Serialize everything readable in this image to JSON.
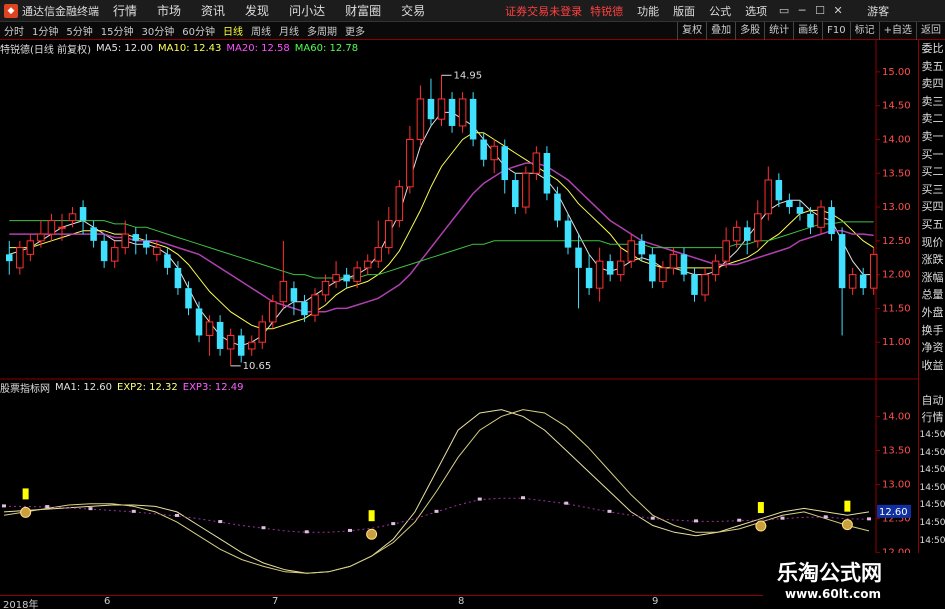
{
  "app": {
    "title": "通达信金融终端",
    "login_status": "证券交易未登录",
    "stock_name": "特锐德",
    "guest": "游客",
    "menus": [
      "行情",
      "市场",
      "资讯",
      "发现",
      "问小达",
      "财富圈",
      "交易"
    ],
    "right_menus": [
      "功能",
      "版面",
      "公式",
      "选项"
    ],
    "window_controls": [
      "▭",
      "─",
      "☐",
      "✕"
    ]
  },
  "toolbar": {
    "periods": [
      "分时",
      "1分钟",
      "5分钟",
      "15分钟",
      "30分钟",
      "60分钟",
      "日线",
      "周线",
      "月线",
      "多周期",
      "更多"
    ],
    "active_period": "日线",
    "right_buttons": [
      "复权",
      "叠加",
      "多股",
      "统计",
      "画线",
      "F10",
      "标记",
      "+自选",
      "返回"
    ]
  },
  "main_panel": {
    "stock_label": "特锐德(日线 前复权)",
    "ma": [
      {
        "label": "MA5: 12.00",
        "color": "#e0e0e0"
      },
      {
        "label": "MA10: 12.43",
        "color": "#ffff50"
      },
      {
        "label": "MA20: 12.58",
        "color": "#ff50ff"
      },
      {
        "label": "MA60: 12.78",
        "color": "#50ff50"
      }
    ],
    "high_label": "14.95",
    "low_label": "10.65",
    "y_ticks": [
      "15.00",
      "14.50",
      "14.00",
      "13.50",
      "13.00",
      "12.50",
      "12.00",
      "11.50",
      "11.00"
    ]
  },
  "sub_panel": {
    "indicator_label": "股票指标网",
    "lines": [
      {
        "label": "MA1: 12.60",
        "color": "#e0e0e0"
      },
      {
        "label": "EXP2: 12.32",
        "color": "#ffff80"
      },
      {
        "label": "EXP3: 12.49",
        "color": "#ff60ff"
      }
    ],
    "y_ticks": [
      "14.00",
      "13.50",
      "13.00",
      "12.50",
      "12.00"
    ],
    "current_value": "12.60"
  },
  "x_axis": {
    "labels": [
      "2018年",
      "6",
      "7",
      "8",
      "9"
    ]
  },
  "side_panel": {
    "labels": [
      "委比",
      "卖五",
      "卖四",
      "卖三",
      "卖二",
      "卖一",
      "买一",
      "买二",
      "买三",
      "买四",
      "买五",
      "现价",
      "涨跌",
      "涨幅",
      "总量",
      "外盘",
      "换手",
      "净资",
      "收益",
      "",
      "自动",
      "行情",
      "14:50",
      "14:50",
      "14:50",
      "14:50",
      "14:50",
      "14:50",
      "14:50",
      "14:50"
    ]
  },
  "watermark": {
    "title": "乐淘公式网",
    "url": "www.60lt.com"
  },
  "chart_data": {
    "type": "candlestick",
    "ylim": [
      10.5,
      15.25
    ],
    "candles": [
      [
        12.3,
        12.2,
        12.5,
        12.0
      ],
      [
        12.1,
        12.4,
        12.5,
        12.0
      ],
      [
        12.3,
        12.5,
        12.6,
        12.2
      ],
      [
        12.5,
        12.6,
        12.8,
        12.4
      ],
      [
        12.6,
        12.8,
        12.9,
        12.5
      ],
      [
        12.7,
        12.7,
        12.9,
        12.5
      ],
      [
        12.8,
        12.9,
        13.0,
        12.7
      ],
      [
        13.0,
        12.8,
        13.1,
        12.6
      ],
      [
        12.7,
        12.5,
        12.8,
        12.4
      ],
      [
        12.5,
        12.2,
        12.6,
        12.1
      ],
      [
        12.2,
        12.4,
        12.5,
        12.1
      ],
      [
        12.4,
        12.6,
        12.8,
        12.3
      ],
      [
        12.6,
        12.5,
        12.7,
        12.3
      ],
      [
        12.5,
        12.4,
        12.6,
        12.3
      ],
      [
        12.3,
        12.4,
        12.5,
        12.2
      ],
      [
        12.3,
        12.1,
        12.4,
        12.0
      ],
      [
        12.1,
        11.8,
        12.2,
        11.7
      ],
      [
        11.8,
        11.5,
        11.9,
        11.4
      ],
      [
        11.5,
        11.1,
        11.6,
        11.0
      ],
      [
        11.1,
        11.3,
        11.4,
        10.8
      ],
      [
        11.3,
        10.9,
        11.4,
        10.8
      ],
      [
        10.9,
        11.1,
        11.2,
        10.65
      ],
      [
        11.1,
        10.8,
        11.2,
        10.7
      ],
      [
        10.9,
        11.0,
        11.1,
        10.8
      ],
      [
        11.0,
        11.3,
        11.4,
        10.9
      ],
      [
        11.3,
        11.6,
        11.7,
        11.2
      ],
      [
        11.6,
        11.9,
        12.5,
        11.5
      ],
      [
        11.8,
        11.6,
        11.9,
        11.4
      ],
      [
        11.6,
        11.4,
        11.7,
        11.3
      ],
      [
        11.4,
        11.7,
        11.8,
        11.3
      ],
      [
        11.7,
        11.9,
        12.0,
        11.6
      ],
      [
        11.9,
        12.0,
        12.2,
        11.8
      ],
      [
        12.0,
        11.9,
        12.1,
        11.8
      ],
      [
        11.9,
        12.1,
        12.2,
        11.8
      ],
      [
        12.1,
        12.2,
        12.3,
        12.0
      ],
      [
        12.2,
        12.4,
        12.8,
        12.1
      ],
      [
        12.4,
        12.8,
        13.0,
        12.3
      ],
      [
        12.8,
        13.3,
        13.4,
        12.7
      ],
      [
        13.3,
        14.0,
        14.2,
        13.2
      ],
      [
        14.0,
        14.6,
        14.8,
        13.9
      ],
      [
        14.6,
        14.3,
        14.9,
        14.2
      ],
      [
        14.3,
        14.6,
        14.95,
        14.2
      ],
      [
        14.6,
        14.2,
        14.7,
        14.1
      ],
      [
        14.2,
        14.6,
        14.7,
        14.1
      ],
      [
        14.6,
        14.0,
        14.7,
        13.9
      ],
      [
        14.0,
        13.7,
        14.1,
        13.6
      ],
      [
        13.7,
        13.9,
        14.0,
        13.5
      ],
      [
        13.9,
        13.4,
        14.0,
        13.2
      ],
      [
        13.4,
        13.0,
        13.5,
        12.9
      ],
      [
        13.0,
        13.5,
        13.6,
        12.9
      ],
      [
        13.5,
        13.8,
        13.9,
        13.4
      ],
      [
        13.8,
        13.2,
        13.9,
        13.1
      ],
      [
        13.2,
        12.8,
        13.3,
        12.7
      ],
      [
        12.8,
        12.4,
        12.9,
        12.3
      ],
      [
        12.4,
        12.1,
        12.6,
        11.5
      ],
      [
        12.1,
        11.8,
        12.3,
        11.7
      ],
      [
        11.8,
        12.2,
        12.4,
        11.6
      ],
      [
        12.2,
        12.0,
        12.3,
        11.9
      ],
      [
        12.0,
        12.2,
        12.4,
        11.9
      ],
      [
        12.2,
        12.5,
        12.6,
        12.1
      ],
      [
        12.5,
        12.3,
        12.6,
        12.2
      ],
      [
        12.3,
        11.9,
        12.4,
        11.8
      ],
      [
        11.9,
        12.1,
        12.2,
        11.8
      ],
      [
        12.1,
        12.3,
        12.4,
        12.0
      ],
      [
        12.3,
        12.0,
        12.4,
        11.9
      ],
      [
        12.0,
        11.7,
        12.1,
        11.6
      ],
      [
        11.7,
        12.0,
        12.1,
        11.6
      ],
      [
        12.0,
        12.2,
        12.3,
        11.9
      ],
      [
        12.2,
        12.5,
        12.7,
        12.1
      ],
      [
        12.5,
        12.7,
        12.8,
        12.4
      ],
      [
        12.7,
        12.5,
        12.8,
        12.3
      ],
      [
        12.5,
        12.9,
        13.1,
        12.4
      ],
      [
        12.9,
        13.4,
        13.6,
        12.8
      ],
      [
        13.4,
        13.1,
        13.5,
        13.0
      ],
      [
        13.1,
        13.0,
        13.2,
        12.9
      ],
      [
        13.0,
        12.9,
        13.1,
        12.8
      ],
      [
        12.9,
        12.7,
        13.0,
        12.6
      ],
      [
        12.7,
        13.0,
        13.1,
        12.6
      ],
      [
        13.0,
        12.6,
        13.1,
        12.5
      ],
      [
        12.6,
        11.8,
        12.7,
        11.1
      ],
      [
        11.8,
        12.0,
        12.1,
        11.7
      ],
      [
        12.0,
        11.8,
        12.1,
        11.7
      ],
      [
        11.8,
        12.3,
        12.4,
        11.7
      ]
    ],
    "series": [
      {
        "name": "MA5",
        "values": [
          12.3,
          12.35,
          12.4,
          12.5,
          12.6,
          12.7,
          12.75,
          12.8,
          12.7,
          12.6,
          12.5,
          12.5,
          12.45,
          12.45,
          12.4,
          12.3,
          12.1,
          11.8,
          11.5,
          11.3,
          11.1,
          11.0,
          10.95,
          11.0,
          11.1,
          11.3,
          11.5,
          11.6,
          11.6,
          11.7,
          11.8,
          11.9,
          11.95,
          12.0,
          12.1,
          12.3,
          12.6,
          12.9,
          13.4,
          13.9,
          14.2,
          14.4,
          14.4,
          14.3,
          14.2,
          14.0,
          13.8,
          13.6,
          13.5,
          13.5,
          13.5,
          13.4,
          13.2,
          12.9,
          12.6,
          12.3,
          12.1,
          12.05,
          12.1,
          12.2,
          12.25,
          12.2,
          12.1,
          12.1,
          12.05,
          12.0,
          12.0,
          12.05,
          12.2,
          12.35,
          12.55,
          12.75,
          12.95,
          13.05,
          13.1,
          13.1,
          12.95,
          12.85,
          12.8,
          12.5,
          12.2,
          12.0,
          12.0
        ]
      },
      {
        "name": "MA10",
        "values": [
          12.4,
          12.4,
          12.4,
          12.45,
          12.5,
          12.55,
          12.6,
          12.65,
          12.65,
          12.65,
          12.6,
          12.6,
          12.55,
          12.5,
          12.45,
          12.4,
          12.3,
          12.15,
          11.95,
          11.75,
          11.6,
          11.45,
          11.35,
          11.25,
          11.2,
          11.2,
          11.25,
          11.3,
          11.35,
          11.45,
          11.55,
          11.7,
          11.8,
          11.85,
          11.9,
          12.0,
          12.15,
          12.35,
          12.65,
          12.95,
          13.3,
          13.6,
          13.8,
          14.0,
          14.1,
          14.1,
          14.0,
          13.9,
          13.8,
          13.7,
          13.6,
          13.5,
          13.4,
          13.25,
          13.05,
          12.9,
          12.75,
          12.6,
          12.4,
          12.3,
          12.2,
          12.15,
          12.1,
          12.1,
          12.1,
          12.1,
          12.1,
          12.1,
          12.15,
          12.2,
          12.25,
          12.35,
          12.5,
          12.6,
          12.75,
          12.9,
          12.95,
          12.95,
          12.9,
          12.8,
          12.65,
          12.5,
          12.4
        ]
      },
      {
        "name": "MA20",
        "values": [
          12.6,
          12.6,
          12.6,
          12.6,
          12.6,
          12.6,
          12.6,
          12.6,
          12.6,
          12.6,
          12.55,
          12.55,
          12.5,
          12.5,
          12.5,
          12.45,
          12.4,
          12.35,
          12.3,
          12.2,
          12.1,
          12.0,
          11.9,
          11.8,
          11.7,
          11.6,
          11.55,
          11.5,
          11.45,
          11.45,
          11.45,
          11.5,
          11.5,
          11.55,
          11.6,
          11.65,
          11.75,
          11.85,
          12.0,
          12.2,
          12.4,
          12.6,
          12.8,
          13.0,
          13.2,
          13.35,
          13.45,
          13.55,
          13.6,
          13.65,
          13.65,
          13.6,
          13.5,
          13.4,
          13.25,
          13.1,
          12.95,
          12.8,
          12.7,
          12.6,
          12.5,
          12.45,
          12.4,
          12.35,
          12.3,
          12.25,
          12.2,
          12.15,
          12.15,
          12.15,
          12.2,
          12.25,
          12.3,
          12.35,
          12.4,
          12.5,
          12.55,
          12.6,
          12.65,
          12.65,
          12.6,
          12.6,
          12.58
        ]
      },
      {
        "name": "MA60",
        "values": [
          12.8,
          12.8,
          12.8,
          12.8,
          12.8,
          12.8,
          12.8,
          12.8,
          12.8,
          12.8,
          12.75,
          12.75,
          12.7,
          12.7,
          12.65,
          12.6,
          12.55,
          12.5,
          12.45,
          12.4,
          12.35,
          12.3,
          12.25,
          12.2,
          12.15,
          12.1,
          12.05,
          12.0,
          12.0,
          11.95,
          11.95,
          11.95,
          11.95,
          11.95,
          12.0,
          12.0,
          12.05,
          12.1,
          12.15,
          12.2,
          12.25,
          12.3,
          12.35,
          12.4,
          12.45,
          12.45,
          12.5,
          12.5,
          12.5,
          12.5,
          12.5,
          12.5,
          12.5,
          12.5,
          12.5,
          12.5,
          12.5,
          12.45,
          12.45,
          12.45,
          12.45,
          12.4,
          12.4,
          12.4,
          12.4,
          12.4,
          12.4,
          12.4,
          12.4,
          12.45,
          12.45,
          12.5,
          12.5,
          12.55,
          12.6,
          12.65,
          12.7,
          12.75,
          12.75,
          12.78,
          12.78,
          12.78,
          12.78
        ]
      }
    ],
    "sub": {
      "ylim": [
        11.6,
        14.3
      ],
      "series": [
        {
          "name": "MA1",
          "values": [
            12.6,
            12.62,
            12.64,
            12.66,
            12.68,
            12.7,
            12.7,
            12.68,
            12.6,
            12.4,
            12.2,
            12.0,
            11.85,
            11.75,
            11.7,
            11.72,
            11.8,
            11.95,
            12.2,
            12.6,
            13.2,
            13.8,
            14.05,
            14.1,
            14.0,
            13.8,
            13.5,
            13.2,
            12.9,
            12.6,
            12.4,
            12.3,
            12.25,
            12.3,
            12.4,
            12.5,
            12.6,
            12.65,
            12.6,
            12.55,
            12.6
          ]
        },
        {
          "name": "EXP2",
          "values": [
            12.55,
            12.6,
            12.65,
            12.7,
            12.72,
            12.72,
            12.68,
            12.6,
            12.45,
            12.25,
            12.05,
            11.9,
            11.8,
            11.72,
            11.7,
            11.72,
            11.8,
            11.95,
            12.15,
            12.45,
            12.9,
            13.4,
            13.8,
            14.0,
            14.1,
            14.05,
            13.85,
            13.55,
            13.2,
            12.85,
            12.55,
            12.4,
            12.3,
            12.3,
            12.35,
            12.45,
            12.55,
            12.6,
            12.5,
            12.4,
            12.32
          ]
        },
        {
          "name": "EXP3",
          "values": [
            12.68,
            12.68,
            12.67,
            12.66,
            12.64,
            12.62,
            12.6,
            12.57,
            12.54,
            12.5,
            12.45,
            12.4,
            12.36,
            12.32,
            12.3,
            12.3,
            12.32,
            12.36,
            12.42,
            12.5,
            12.6,
            12.7,
            12.78,
            12.8,
            12.8,
            12.76,
            12.72,
            12.66,
            12.6,
            12.55,
            12.5,
            12.48,
            12.46,
            12.46,
            12.47,
            12.48,
            12.5,
            12.52,
            12.52,
            12.5,
            12.49
          ]
        }
      ],
      "signals": [
        1,
        17,
        35,
        39
      ]
    }
  }
}
